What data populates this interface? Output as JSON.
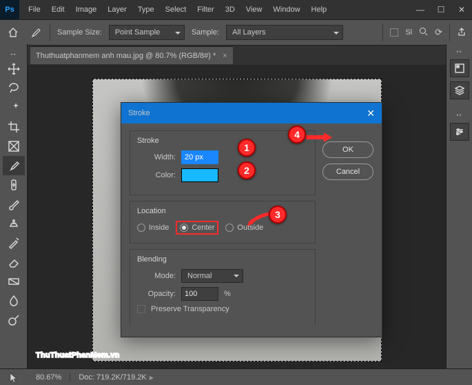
{
  "menu": {
    "items": [
      "File",
      "Edit",
      "Image",
      "Layer",
      "Type",
      "Select",
      "Filter",
      "3D",
      "View",
      "Window",
      "Help"
    ]
  },
  "optbar": {
    "sampleSizeLabel": "Sample Size:",
    "sampleSizeValue": "Point Sample",
    "sampleLabel": "Sample:",
    "sampleValue": "All Layers",
    "slLabel": "Sl"
  },
  "doc": {
    "title": "Thuthuatphanmem anh mau.jpg @ 80.7% (RGB/8#) *"
  },
  "status": {
    "zoom": "80.67%",
    "docinfo": "Doc: 719.2K/719.2K"
  },
  "dialog": {
    "title": "Stroke",
    "ok": "OK",
    "cancel": "Cancel",
    "stroke": {
      "group": "Stroke",
      "widthLabel": "Width:",
      "width": "20 px",
      "colorLabel": "Color:",
      "colorHex": "#18b9ff"
    },
    "location": {
      "group": "Location",
      "inside": "Inside",
      "center": "Center",
      "outside": "Outside",
      "selected": "center"
    },
    "blending": {
      "group": "Blending",
      "modeLabel": "Mode:",
      "mode": "Normal",
      "opacityLabel": "Opacity:",
      "opacity": "100",
      "pct": "%",
      "preserve": "Preserve Transparency"
    }
  },
  "badges": {
    "b1": "1",
    "b2": "2",
    "b3": "3",
    "b4": "4"
  },
  "watermark": {
    "a": "ThuThuat",
    "b": "PhanMem",
    "c": ".vn"
  }
}
